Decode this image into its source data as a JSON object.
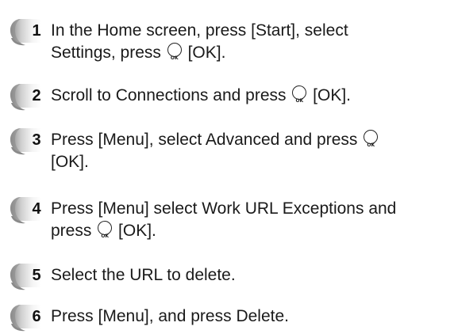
{
  "ok_key_label": "OK",
  "badge_colors": {
    "light": "#f4f4f4",
    "mid": "#cfcfcf",
    "dark": "#8a8a8a"
  },
  "steps": [
    {
      "number": "1",
      "lines": [
        [
          "In the Home screen, press [Start], select"
        ],
        [
          "Settings, press ",
          "{OK}",
          " [OK]."
        ]
      ]
    },
    {
      "number": "2",
      "lines": [
        [
          "Scroll to Connections and press ",
          "{OK}",
          " [OK]."
        ]
      ]
    },
    {
      "number": "3",
      "lines": [
        [
          "Press [Menu], select Advanced and press ",
          "{OK}"
        ],
        [
          "[OK]."
        ]
      ]
    },
    {
      "number": "4",
      "lines": [
        [
          "Press [Menu] select Work URL Exceptions and"
        ],
        [
          "press ",
          "{OK}",
          " [OK]."
        ]
      ]
    },
    {
      "number": "5",
      "lines": [
        [
          "Select the URL to delete."
        ]
      ]
    },
    {
      "number": "6",
      "lines": [
        [
          "Press [Menu], and press Delete."
        ]
      ]
    }
  ]
}
